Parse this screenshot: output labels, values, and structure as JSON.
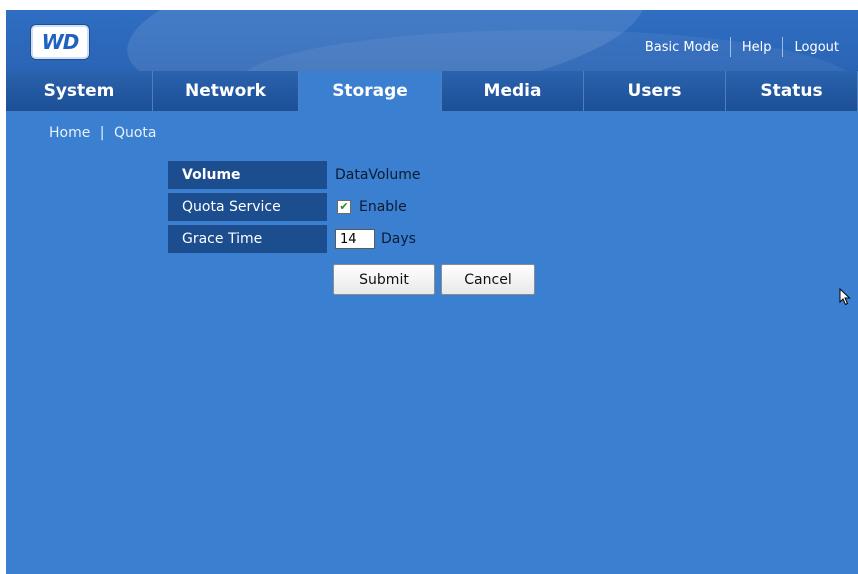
{
  "header": {
    "logo_text": "WD",
    "links": [
      "Basic Mode",
      "Help",
      "Logout"
    ]
  },
  "nav": {
    "tabs": [
      "System",
      "Network",
      "Storage",
      "Media",
      "Users",
      "Status"
    ],
    "active": "Storage"
  },
  "breadcrumb": {
    "home": "Home",
    "separator": "|",
    "current": "Quota"
  },
  "quota": {
    "volume_label": "Volume",
    "volume_value": "DataVolume",
    "service_label": "Quota Service",
    "service_enabled": true,
    "service_value": "Enable",
    "grace_label": "Grace Time",
    "grace_value": "14",
    "grace_unit": "Days"
  },
  "buttons": {
    "submit": "Submit",
    "cancel": "Cancel"
  },
  "colors": {
    "background": "#3a7fd0",
    "nav_dark": "#1c4f96",
    "label_bg": "#1c4d8e"
  }
}
